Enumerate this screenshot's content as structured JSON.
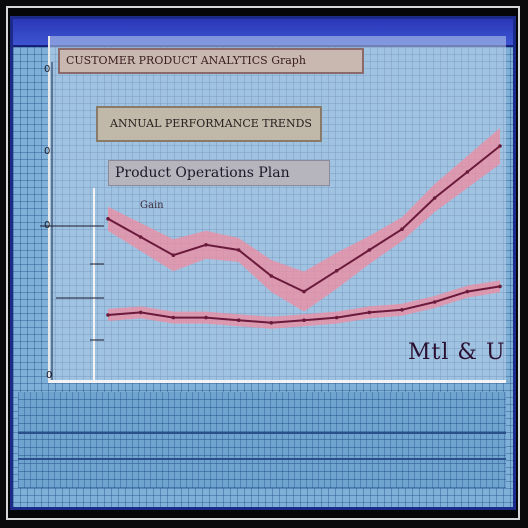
{
  "header": {
    "title": "CUSTOMER PRODUCT ANALYTICS Graph",
    "subtitle": "ANNUAL PERFORMANCE TRENDS",
    "chart_label": "Product Operations Plan",
    "small_label": "Gain"
  },
  "axis": {
    "ticks": [
      "0",
      "0",
      "0",
      "0"
    ]
  },
  "annotation": "Mtl & U",
  "colors": {
    "band": "#f08ca0",
    "line": "#6a1a3a",
    "monitor": "#7fb1d8",
    "titlebar": "#2a38b8"
  },
  "chart_data": {
    "type": "area",
    "x": [
      0,
      1,
      2,
      3,
      4,
      5,
      6,
      7,
      8,
      9,
      10,
      11,
      12
    ],
    "series": [
      {
        "values": [
          62,
          55,
          48,
          52,
          50,
          40,
          34,
          42,
          50,
          58,
          70,
          80,
          90
        ]
      },
      {
        "values": [
          25,
          26,
          24,
          24,
          23,
          22,
          23,
          24,
          26,
          27,
          30,
          34,
          36
        ]
      }
    ],
    "ylim": [
      0,
      100
    ]
  }
}
